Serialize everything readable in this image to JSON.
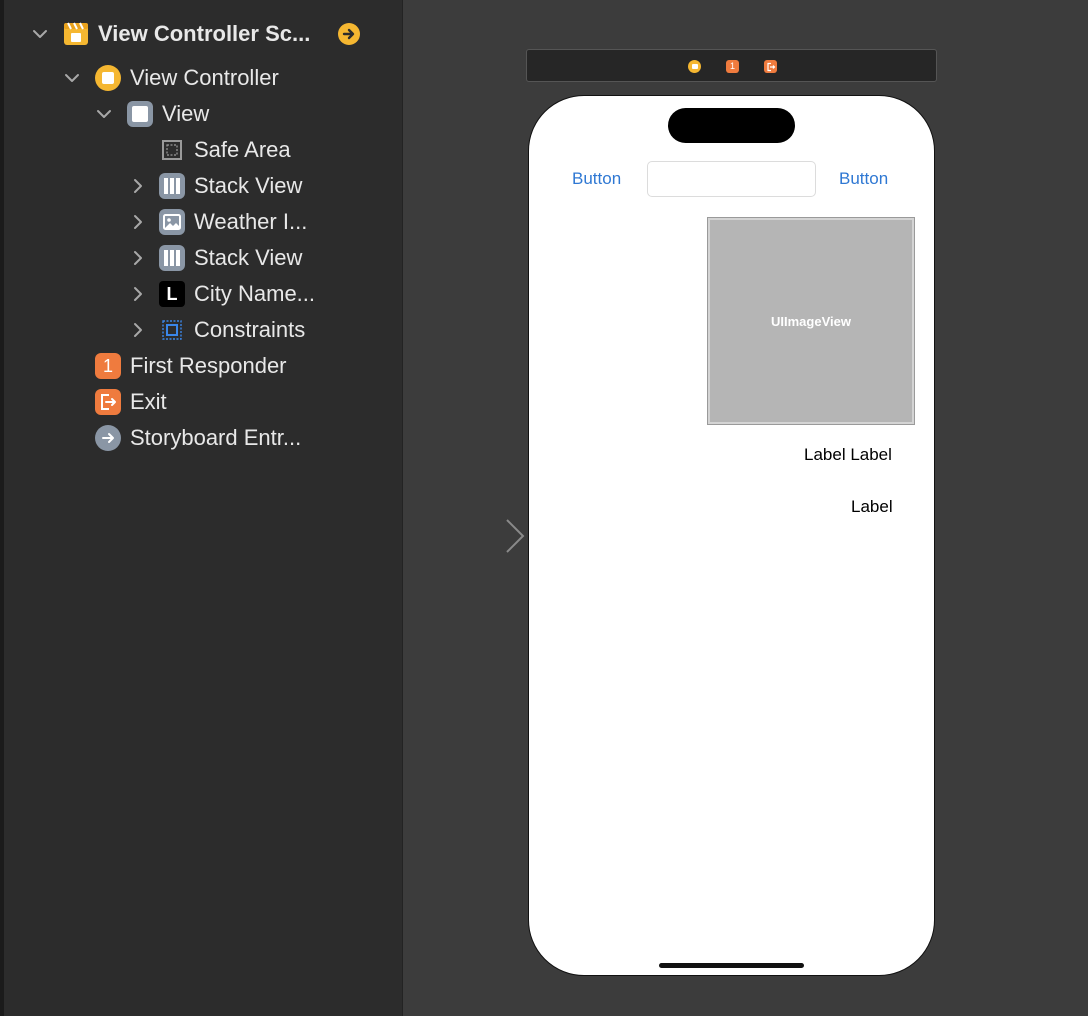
{
  "outline": {
    "scene": {
      "title": "View Controller Sc..."
    },
    "items": [
      {
        "label": "View Controller"
      },
      {
        "label": "View"
      },
      {
        "label": "Safe Area"
      },
      {
        "label": "Stack View"
      },
      {
        "label": "Weather I..."
      },
      {
        "label": "Stack View"
      },
      {
        "label": "City Name..."
      },
      {
        "label": "Constraints"
      },
      {
        "label": "First Responder"
      },
      {
        "label": "Exit"
      },
      {
        "label": "Storyboard Entr..."
      }
    ],
    "icon_glyphs": {
      "first_responder": "1",
      "label_view": "L"
    }
  },
  "canvas": {
    "scene_bar": {
      "first_responder_glyph": "1"
    },
    "phone": {
      "left_button": "Button",
      "right_button": "Button",
      "textfield_value": "",
      "imageview_placeholder": "UIImageView",
      "label_1": "Label Label",
      "label_2": "Label"
    }
  },
  "colors": {
    "accent_yellow": "#f5b731",
    "accent_orange": "#ef7b3e",
    "icon_gray": "#8a96a5",
    "link_blue": "#2f78d3"
  },
  "icons": [
    "scene-icon",
    "go-to-icon",
    "chevron-down-icon",
    "chevron-right-icon",
    "view-controller-icon",
    "view-icon",
    "safe-area-icon",
    "stack-view-icon",
    "image-view-icon",
    "label-icon",
    "constraints-icon",
    "first-responder-icon",
    "exit-icon",
    "storyboard-entry-icon",
    "entry-point-arrow-icon"
  ]
}
